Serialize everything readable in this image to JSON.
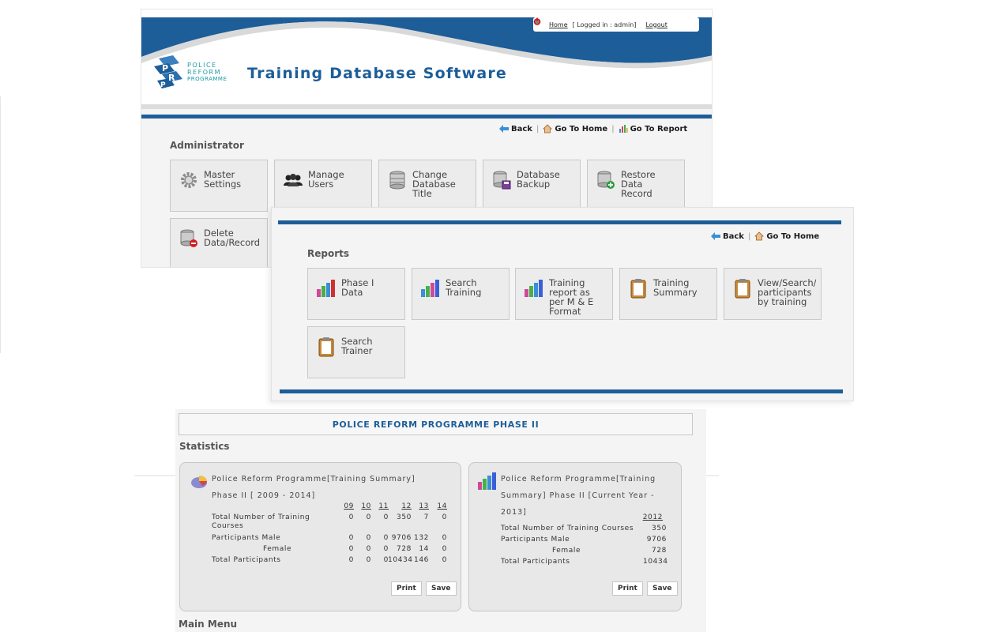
{
  "header": {
    "home_label": "Home",
    "logged_in_text": "[ Logged in : admin]",
    "logout_label": "Logout",
    "logo_lines": [
      "POLICE",
      "REFORM",
      "PROGRAMME"
    ],
    "app_title": "Training Database Software"
  },
  "admin_nav": {
    "back": "Back",
    "go_home": "Go To Home",
    "go_report": "Go To Report"
  },
  "admin": {
    "section_title": "Administrator",
    "tiles": [
      {
        "label": "Master\nSettings",
        "icon": "gear-icon"
      },
      {
        "label": "Manage\nUsers",
        "icon": "users-icon"
      },
      {
        "label": "Change\nDatabase\nTitle",
        "icon": "database-icon"
      },
      {
        "label": "Database\nBackup",
        "icon": "database-backup-icon"
      },
      {
        "label": "Restore\nData\nRecord",
        "icon": "database-restore-icon"
      },
      {
        "label": "Delete\nData/Record",
        "icon": "database-delete-icon"
      }
    ]
  },
  "reports_nav": {
    "back": "Back",
    "go_home": "Go To Home"
  },
  "reports": {
    "section_title": "Reports",
    "tiles": [
      {
        "label": "Phase I\nData",
        "icon": "bar-chart-icon"
      },
      {
        "label": "Search\nTraining",
        "icon": "bar-chart-icon"
      },
      {
        "label": "Training\nreport as\nper M & E\nFormat",
        "icon": "bar-chart-icon"
      },
      {
        "label": "Training\nSummary",
        "icon": "clipboard-icon"
      },
      {
        "label": "View/Search/p\nparticipants\nby training",
        "icon": "clipboard-icon"
      },
      {
        "label": "Search\nTrainer",
        "icon": "clipboard-icon"
      }
    ]
  },
  "stats": {
    "banner": "POLICE REFORM PROGRAMME PHASE II",
    "section_title": "Statistics",
    "main_menu": "Main Menu",
    "summary": {
      "title_line1": "Police Reform Programme[Training Summary]",
      "title_line2": "Phase II    [ 2009 - 2014]",
      "years": [
        "09",
        "10",
        "11",
        "12",
        "13",
        "14"
      ],
      "rows": [
        {
          "label": "Total Number of Training\nCourses",
          "values": [
            "0",
            "0",
            "0",
            "350",
            "7",
            "0"
          ]
        },
        {
          "label": "Participants Male",
          "values": [
            "0",
            "0",
            "0",
            "9706",
            "132",
            "0"
          ]
        },
        {
          "label": "Female",
          "values": [
            "0",
            "0",
            "0",
            "728",
            "14",
            "0"
          ]
        },
        {
          "label": "Total Participants",
          "values": [
            "0",
            "0",
            "0",
            "10434",
            "146",
            "0"
          ]
        }
      ],
      "print_label": "Print",
      "save_label": "Save"
    },
    "current_year": {
      "title_line1": "Police Reform Programme[Training",
      "title_line2": "Summary] Phase II [Current Year -",
      "title_line3": "2013]",
      "year": "2012",
      "rows": [
        {
          "label": "Total Number of Training Courses",
          "value": "350"
        },
        {
          "label": "Participants Male",
          "value": "9706"
        },
        {
          "label": "Female",
          "value": "728"
        },
        {
          "label": "Total Participants",
          "value": "10434"
        }
      ],
      "print_label": "Print",
      "save_label": "Save"
    }
  },
  "colors": {
    "brand_blue": "#1d5e99",
    "logo_teal": "#1a9aa8",
    "tile_bg": "#ececec"
  }
}
